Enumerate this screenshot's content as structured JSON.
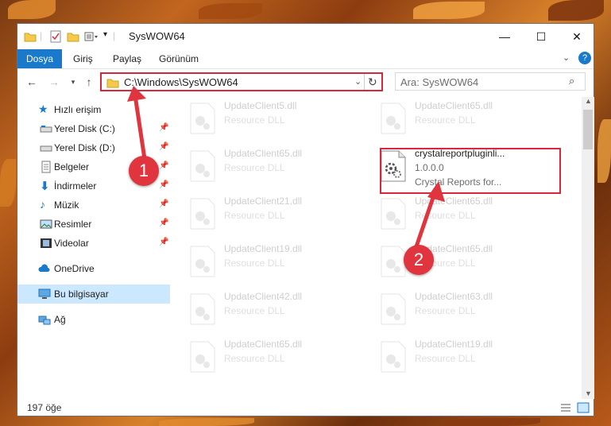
{
  "window": {
    "title": "SysWOW64",
    "minimize": "—",
    "maximize": "☐",
    "close": "✕"
  },
  "ribbon": {
    "tabs": [
      "Dosya",
      "Giriş",
      "Paylaş",
      "Görünüm"
    ]
  },
  "nav": {
    "address": "C:\\Windows\\SysWOW64",
    "search_placeholder": "Ara: SysWOW64"
  },
  "sidebar": {
    "items": [
      {
        "label": "Hızlı erişim",
        "icon": "star-icon"
      },
      {
        "label": "Yerel Disk (C:)",
        "icon": "drive-icon"
      },
      {
        "label": "Yerel Disk (D:)",
        "icon": "drive-icon"
      },
      {
        "label": "Belgeler",
        "icon": "documents-icon"
      },
      {
        "label": "İndirmeler",
        "icon": "download-icon"
      },
      {
        "label": "Müzik",
        "icon": "music-icon"
      },
      {
        "label": "Resimler",
        "icon": "pictures-icon"
      },
      {
        "label": "Videolar",
        "icon": "videos-icon"
      },
      {
        "label": "OneDrive",
        "icon": "cloud-icon"
      },
      {
        "label": "Bu bilgisayar",
        "icon": "computer-icon"
      },
      {
        "label": "Ağ",
        "icon": "network-icon"
      }
    ]
  },
  "files": {
    "left": [
      {
        "name": "UpdateClient5.dll",
        "type": "Resource DLL"
      },
      {
        "name": "UpdateClient65.dll",
        "type": "Resource DLL"
      },
      {
        "name": "UpdateClient21.dll",
        "type": "Resource DLL"
      },
      {
        "name": "UpdateClient19.dll",
        "type": "Resource DLL"
      },
      {
        "name": "UpdateClient42.dll",
        "type": "Resource DLL"
      },
      {
        "name": "UpdateClient65.dll",
        "type": "Resource DLL"
      }
    ],
    "right": [
      {
        "name": "UpdateClient65.dll",
        "type": "Resource DLL"
      },
      {
        "name": "UpdateClient65.dll",
        "type": "Resource DLL"
      },
      {
        "name": "UpdateClient65.dll",
        "type": "Resource DLL"
      },
      {
        "name": "UpdateClient63.dll",
        "type": "Resource DLL"
      },
      {
        "name": "UpdateClient19.dll",
        "type": "Resource DLL"
      }
    ],
    "highlighted": {
      "name": "crystalreportpluginli...",
      "version": "1.0.0.0",
      "description": "Crystal Reports for..."
    }
  },
  "annotations": {
    "badge1": "1",
    "badge2": "2"
  },
  "status": {
    "count": "197 öğe"
  },
  "colors": {
    "accent": "#1979ca",
    "highlight": "#d8273a",
    "selected": "#cce8ff"
  }
}
